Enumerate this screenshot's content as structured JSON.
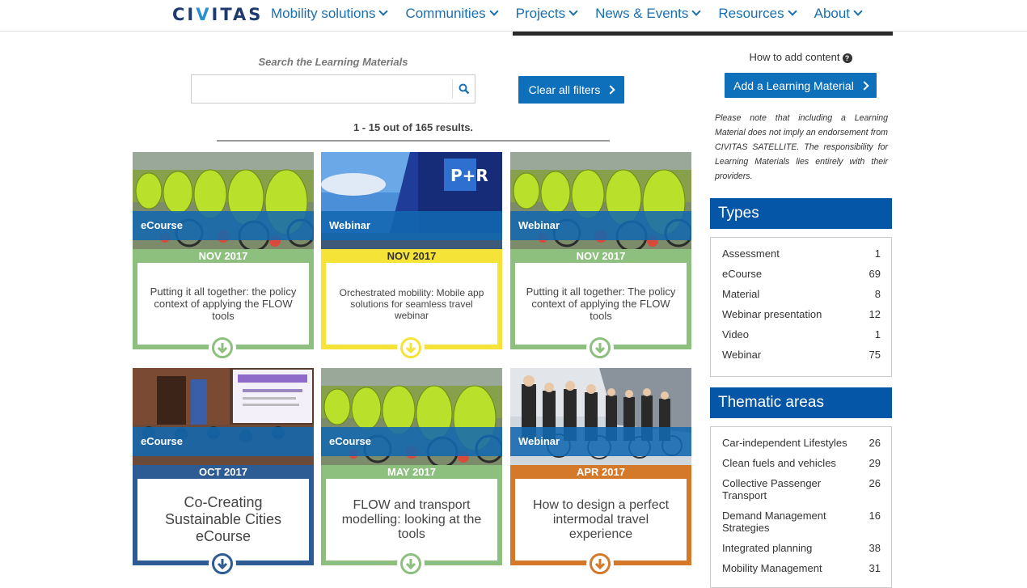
{
  "brand": {
    "logo_prefix": "CI",
    "logo_accent": "V",
    "logo_suffix": "ITAS"
  },
  "nav": [
    {
      "label": "Mobility solutions"
    },
    {
      "label": "Communities"
    },
    {
      "label": "Projects"
    },
    {
      "label": "News & Events"
    },
    {
      "label": "Resources"
    },
    {
      "label": "About"
    }
  ],
  "search": {
    "label": "Search the Learning Materials",
    "value": "",
    "placeholder": ""
  },
  "clear_filters": "Clear all filters",
  "results_text": "1 - 15 out of 165 results.",
  "cards": [
    {
      "type": "eCourse",
      "date": "NOV 2017",
      "title": "Putting it all together: the policy context of applying the FLOW tools",
      "color": "#8dbf7e",
      "image": "bikes"
    },
    {
      "type": "Webinar",
      "date": "NOV 2017",
      "title": "Orchestrated mobility: Mobile app solutions for seamless travel webinar",
      "color": "#f5e437",
      "image": "parking"
    },
    {
      "type": "Webinar",
      "date": "NOV 2017",
      "title": "Putting it all together: The policy context of applying the FLOW tools",
      "color": "#8dbf7e",
      "image": "bikes"
    },
    {
      "type": "eCourse",
      "date": "OCT 2017",
      "title": "Co-Creating Sustainable Cities eCourse",
      "color": "#2d5b94",
      "image": "conference"
    },
    {
      "type": "eCourse",
      "date": "MAY 2017",
      "title": "FLOW and transport modelling: looking at the tools",
      "color": "#8dbf7e",
      "image": "bikes"
    },
    {
      "type": "Webinar",
      "date": "APR 2017",
      "title": "How to design a perfect intermodal travel experience",
      "color": "#d4782a",
      "image": "group"
    }
  ],
  "sidebar": {
    "howto": "How to add content",
    "add_button": "Add a Learning Material",
    "note": "Please note that including a Learning Material does not imply an endorsement from CIVITAS SATELLITE. The responsibility for Learning Materials lies entirely with their providers.",
    "types_title": "Types",
    "types": [
      {
        "label": "Assessment",
        "count": "1"
      },
      {
        "label": "eCourse",
        "count": "69"
      },
      {
        "label": "Material",
        "count": "8"
      },
      {
        "label": "Webinar presentation",
        "count": "12"
      },
      {
        "label": "Video",
        "count": "1"
      },
      {
        "label": "Webinar",
        "count": "75"
      }
    ],
    "thematic_title": "Thematic areas",
    "thematic": [
      {
        "label": "Car-independent Lifestyles",
        "count": "26"
      },
      {
        "label": "Clean fuels and vehicles",
        "count": "29"
      },
      {
        "label": "Collective Passenger Transport",
        "count": "26"
      },
      {
        "label": "Demand Management Strategies",
        "count": "16"
      },
      {
        "label": "Integrated planning",
        "count": "38"
      },
      {
        "label": "Mobility Management",
        "count": "31"
      }
    ]
  },
  "colors": {
    "brand_blue": "#0556a6",
    "button_blue": "#0e6fba",
    "link_blue": "#1a6fb0"
  }
}
